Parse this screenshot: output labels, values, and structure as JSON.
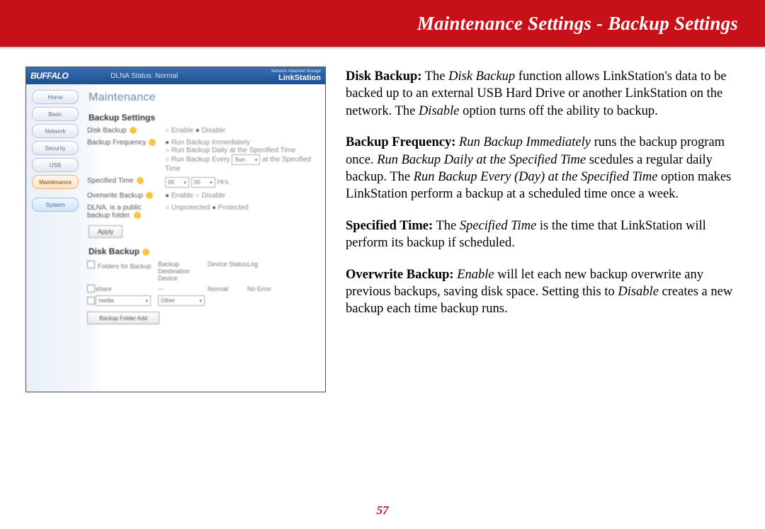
{
  "header": {
    "title": "Maintenance Settings - Backup Settings"
  },
  "page_number": "57",
  "screenshot": {
    "logo": "BUFFALO",
    "dlna_status": "DLNA Status: Normal",
    "brand_small": "Network Attached Storage",
    "brand": "LinkStation",
    "sidebar": {
      "items": [
        {
          "label": "Home"
        },
        {
          "label": "Basic"
        },
        {
          "label": "Network"
        },
        {
          "label": "Security"
        },
        {
          "label": "USB"
        },
        {
          "label": "Maintenance"
        },
        {
          "label": "System"
        }
      ]
    },
    "main": {
      "h1": "Maintenance",
      "h2a": "Backup Settings",
      "rows": {
        "disk_backup_label": "Disk Backup",
        "disk_backup_opts": {
          "enable": "Enable",
          "disable": "Disable"
        },
        "backup_freq_label": "Backup Frequency",
        "backup_freq_opts": {
          "immediate": "Run Backup Immediately",
          "daily": "Run Backup Daily at the Specified Time",
          "weekly_prefix": "Run Backup Every",
          "weekly_day": "Sun.",
          "weekly_suffix": "at the Specified Time"
        },
        "spec_time_label": "Specified Time",
        "spec_time_hh": "00",
        "spec_time_mm": "00",
        "spec_time_unit": "Hrs.",
        "overwrite_label": "Overwrite Backup",
        "overwrite_opts": {
          "enable": "Enable",
          "disable": "Disable"
        },
        "dlna_label": "DLNA, is a public backup folder.",
        "dlna_opts": {
          "unprotected": "Unprotected",
          "protected": "Protected"
        }
      },
      "apply": "Apply",
      "h2b": "Disk Backup",
      "table": {
        "col_folder": "Folders for Backup",
        "col_dest": "Backup Destination Device",
        "col_devstat": "Device Status",
        "col_log": "Log",
        "row1_folder": "share",
        "row1_dest": "---",
        "row1_status": "Normal",
        "row1_log": "No Error",
        "row2_folder": "media",
        "row2_dest": "Other"
      },
      "add_btn": "Backup Folder Add"
    }
  },
  "desc": {
    "p1_term": "Disk Backup:",
    "p1_a": "  The ",
    "p1_i1": "Disk Backup",
    "p1_b": " function allows LinkStation's data to be backed up to an external USB Hard Drive or another LinkStation on the network.  The ",
    "p1_i2": "Disable",
    "p1_c": " option turns off the ability to backup.",
    "p2_term": "Backup Frequency:",
    "p2_a": "  ",
    "p2_i1": "Run Backup Immediately",
    "p2_b": " runs the backup program once.  ",
    "p2_i2": "Run Backup Daily at the Specified Time",
    "p2_c": " scedules a regular daily backup.  The ",
    "p2_i3": "Run Backup Every (Day) at the Specified Time",
    "p2_d": " option makes LinkStation perform a backup at a scheduled time once a week.",
    "p3_term": "Specified Time:",
    "p3_a": "  The ",
    "p3_i1": "Specified Time",
    "p3_b": " is the time that LinkStation will perform its backup if scheduled.",
    "p4_term": "Overwrite Backup:",
    "p4_a": "  ",
    "p4_i1": "Enable",
    "p4_b": " will let each new backup overwrite any previous backups, saving disk space.  Setting this to ",
    "p4_i2": "Disable",
    "p4_c": " creates a new backup each time backup runs."
  }
}
